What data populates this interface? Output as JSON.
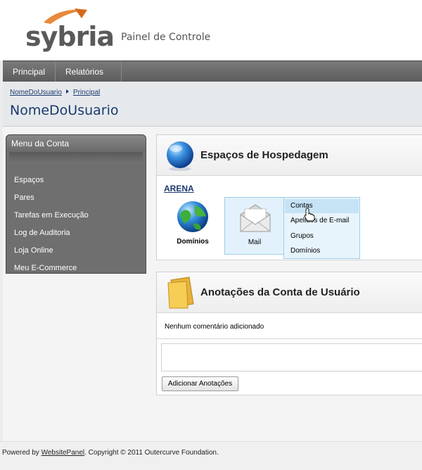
{
  "brand": {
    "logo_text": "sybria",
    "panel_title": "Painel de Controle"
  },
  "topnav": {
    "items": [
      "Principal",
      "Relatórios"
    ]
  },
  "breadcrumb": {
    "items": [
      "NomeDoUsuario",
      "Principal"
    ]
  },
  "page_title": "NomeDoUsuario",
  "menu": {
    "title": "Menu da Conta",
    "items": [
      "Espaços",
      "Pares",
      "Tarefas em Execução",
      "Log de Auditoria",
      "Loja Online",
      "Meu E-Commerce"
    ]
  },
  "spaces": {
    "title": "Espaços de Hospedagem",
    "space_name": "ARENA",
    "icons": [
      "Domínios",
      "Mail"
    ],
    "popup": [
      "Contas",
      "Apelidos de E-mail",
      "Grupos",
      "Domínios"
    ]
  },
  "notes": {
    "title": "Anotações da Conta de Usuário",
    "empty_text": "Nenhum comentário adicionado",
    "add_button": "Adicionar Anotações"
  },
  "footer": {
    "prefix": "Powered by ",
    "link": "WebsitePanel",
    "suffix": ". Copyright © 2011 Outercurve Foundation."
  },
  "colors": {
    "link": "#1a3a6e",
    "nav": "#6a6a6a",
    "menu": "#6f6f6f",
    "highlight": "#c6e2f5"
  }
}
